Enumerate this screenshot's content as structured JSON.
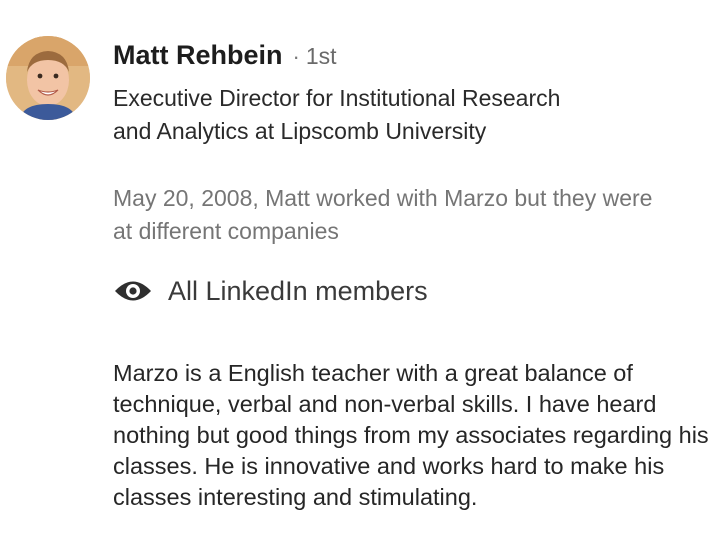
{
  "recommendation": {
    "author": {
      "name": "Matt Rehbein",
      "separator": "·",
      "degree": "1st",
      "headline": "Executive Director for Institutional Research and Analytics at Lipscomb University",
      "avatar_icon": "person-photo"
    },
    "relationship": "May 20, 2008, Matt worked with Marzo but they were at different companies",
    "visibility": {
      "icon": "eye-icon",
      "label": "All LinkedIn members"
    },
    "text": "Marzo is a English teacher with a great balance of technique, verbal and non-verbal skills.  I have heard nothing but good things from my associates regarding his classes.  He is innovative and works hard to make his classes interesting and stimulating."
  }
}
